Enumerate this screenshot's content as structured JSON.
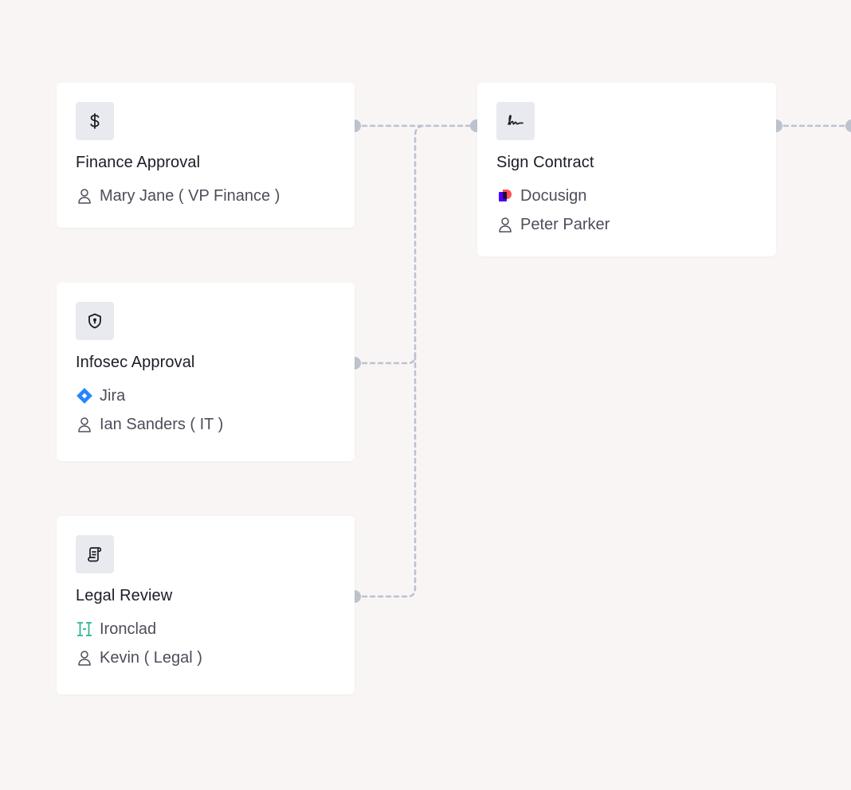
{
  "cards": [
    {
      "title": "Finance Approval",
      "icon": "dollar-icon",
      "rows": [
        {
          "icon": "user-icon",
          "text": "Mary Jane ( VP Finance )"
        }
      ]
    },
    {
      "title": "Infosec Approval",
      "icon": "shield-icon",
      "rows": [
        {
          "icon": "jira-logo-icon",
          "text": "Jira"
        },
        {
          "icon": "user-icon",
          "text": "Ian Sanders ( IT )"
        }
      ]
    },
    {
      "title": "Legal Review",
      "icon": "scroll-document-icon",
      "rows": [
        {
          "icon": "ironclad-logo-icon",
          "text": "Ironclad"
        },
        {
          "icon": "user-icon",
          "text": "Kevin ( Legal )"
        }
      ]
    },
    {
      "title": "Sign Contract",
      "icon": "signature-icon",
      "rows": [
        {
          "icon": "docusign-logo-icon",
          "text": "Docusign"
        },
        {
          "icon": "user-icon",
          "text": "Peter Parker"
        }
      ]
    }
  ],
  "colors": {
    "background": "#f9f5f5",
    "card": "#ffffff",
    "icon_tile": "#e8eaef",
    "connector": "#bcc2ce",
    "jira_blue": "#2684ff",
    "ironclad_teal": "#2bb69a",
    "docusign_purple": "#4c00ff",
    "docusign_orange": "#ff5252"
  }
}
